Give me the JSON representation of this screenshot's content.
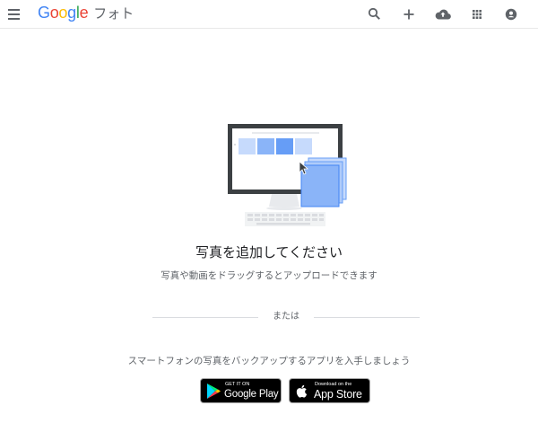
{
  "header": {
    "logo": {
      "google_letters": [
        "G",
        "o",
        "o",
        "g",
        "l",
        "e"
      ],
      "product_name": "フォト"
    },
    "icons": [
      "menu-icon",
      "search-icon",
      "add-icon",
      "cloud-upload-icon",
      "apps-grid-icon",
      "account-icon"
    ]
  },
  "main": {
    "title": "写真を追加してください",
    "subtitle": "写真や動画をドラッグするとアップロードできます",
    "divider_text": "または",
    "backup_text": "スマートフォンの写真をバックアップするアプリを入手しましょう"
  },
  "badges": {
    "google_play": {
      "small": "GET IT ON",
      "big": "Google Play"
    },
    "app_store": {
      "small": "Download on the",
      "big": "App Store"
    }
  },
  "colors": {
    "google_blue": "#4285f4",
    "google_red": "#ea4335",
    "google_yellow": "#fbbc05",
    "google_green": "#34a853",
    "icon_gray": "#5f6368",
    "monitor_frame": "#3c4043",
    "photo_blue": "#8ab4f8",
    "photo_light_blue": "#c6dafc"
  }
}
